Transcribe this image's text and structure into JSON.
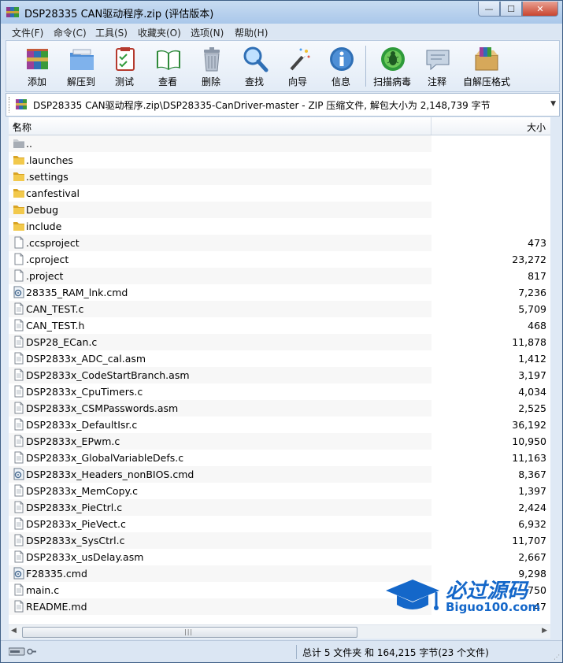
{
  "window": {
    "title": "DSP28335 CAN驱动程序.zip (评估版本)",
    "controls": {
      "minimize": "—",
      "maximize": "☐",
      "close": "✕"
    }
  },
  "menu": [
    "文件(F)",
    "命令(C)",
    "工具(S)",
    "收藏夹(O)",
    "选项(N)",
    "帮助(H)"
  ],
  "toolbar": [
    {
      "label": "添加",
      "icon": "add-archive-icon"
    },
    {
      "label": "解压到",
      "icon": "extract-to-icon"
    },
    {
      "label": "测试",
      "icon": "test-icon"
    },
    {
      "label": "查看",
      "icon": "view-icon"
    },
    {
      "label": "删除",
      "icon": "delete-icon"
    },
    {
      "label": "查找",
      "icon": "find-icon"
    },
    {
      "label": "向导",
      "icon": "wizard-icon"
    },
    {
      "label": "信息",
      "icon": "info-icon"
    },
    {
      "label": "扫描病毒",
      "icon": "virus-scan-icon"
    },
    {
      "label": "注释",
      "icon": "comment-icon"
    },
    {
      "label": "自解压格式",
      "icon": "sfx-icon"
    }
  ],
  "address": {
    "path": "DSP28335 CAN驱动程序.zip\\DSP28335-CanDriver-master - ZIP 压缩文件, 解包大小为 2,148,739 字节"
  },
  "columns": {
    "name": "名称",
    "size": "大小"
  },
  "files": [
    {
      "name": "..",
      "size": "",
      "type": "parent"
    },
    {
      "name": ".launches",
      "size": "",
      "type": "folder"
    },
    {
      "name": ".settings",
      "size": "",
      "type": "folder"
    },
    {
      "name": "canfestival",
      "size": "",
      "type": "folder"
    },
    {
      "name": "Debug",
      "size": "",
      "type": "folder"
    },
    {
      "name": "include",
      "size": "",
      "type": "folder"
    },
    {
      "name": ".ccsproject",
      "size": "473",
      "type": "file"
    },
    {
      "name": ".cproject",
      "size": "23,272",
      "type": "file"
    },
    {
      "name": ".project",
      "size": "817",
      "type": "file"
    },
    {
      "name": "28335_RAM_lnk.cmd",
      "size": "7,236",
      "type": "cmd"
    },
    {
      "name": "CAN_TEST.c",
      "size": "5,709",
      "type": "code"
    },
    {
      "name": "CAN_TEST.h",
      "size": "468",
      "type": "code"
    },
    {
      "name": "DSP28_ECan.c",
      "size": "11,878",
      "type": "code"
    },
    {
      "name": "DSP2833x_ADC_cal.asm",
      "size": "1,412",
      "type": "code"
    },
    {
      "name": "DSP2833x_CodeStartBranch.asm",
      "size": "3,197",
      "type": "code"
    },
    {
      "name": "DSP2833x_CpuTimers.c",
      "size": "4,034",
      "type": "code"
    },
    {
      "name": "DSP2833x_CSMPasswords.asm",
      "size": "2,525",
      "type": "code"
    },
    {
      "name": "DSP2833x_DefaultIsr.c",
      "size": "36,192",
      "type": "code"
    },
    {
      "name": "DSP2833x_EPwm.c",
      "size": "10,950",
      "type": "code"
    },
    {
      "name": "DSP2833x_GlobalVariableDefs.c",
      "size": "11,163",
      "type": "code"
    },
    {
      "name": "DSP2833x_Headers_nonBIOS.cmd",
      "size": "8,367",
      "type": "cmd"
    },
    {
      "name": "DSP2833x_MemCopy.c",
      "size": "1,397",
      "type": "code"
    },
    {
      "name": "DSP2833x_PieCtrl.c",
      "size": "2,424",
      "type": "code"
    },
    {
      "name": "DSP2833x_PieVect.c",
      "size": "6,932",
      "type": "code"
    },
    {
      "name": "DSP2833x_SysCtrl.c",
      "size": "11,707",
      "type": "code"
    },
    {
      "name": "DSP2833x_usDelay.asm",
      "size": "2,667",
      "type": "code"
    },
    {
      "name": "F28335.cmd",
      "size": "9,298",
      "type": "cmd"
    },
    {
      "name": "main.c",
      "size": "750",
      "type": "code"
    },
    {
      "name": "README.md",
      "size": "47",
      "type": "code"
    }
  ],
  "status": {
    "text": "总计 5 文件夹 和 164,215 字节(23 个文件)"
  },
  "watermark": {
    "zh": "必过源码",
    "en": "Biguo100.com"
  },
  "colors": {
    "folder": "#e8b93a",
    "titlebar": "#b6cfee",
    "watermark": "#1467c9"
  }
}
